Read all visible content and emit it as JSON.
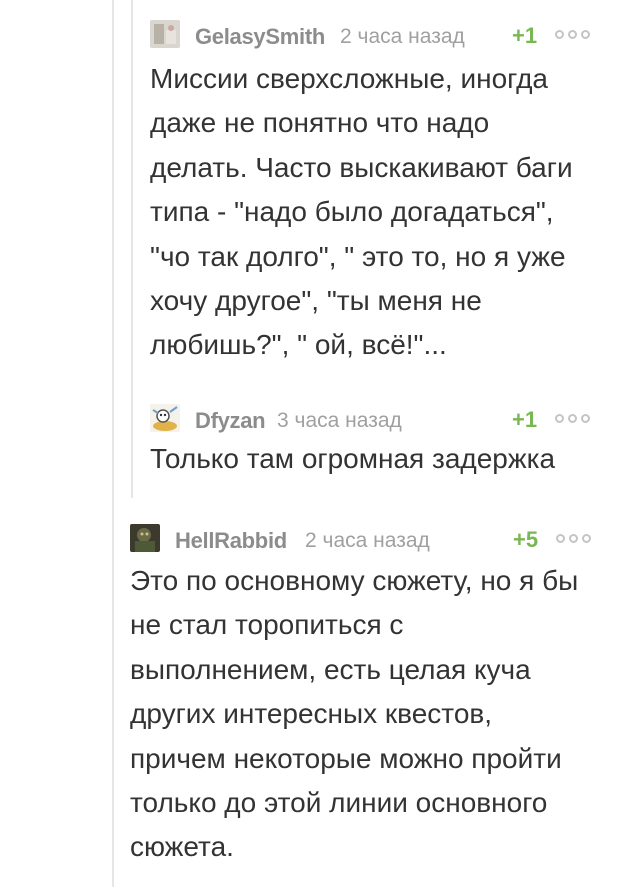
{
  "comments": [
    {
      "author": "GelasySmith",
      "time": "2 часа назад",
      "rating": "+1",
      "lines": [
        "Миссии сверхсложные, иногда",
        "даже не понятно что надо",
        "делать. Часто выскакивают баги",
        "типа - \"надо было догадаться\",",
        "\"чо так долго\", \" это то, но я уже",
        "хочу другое\", \"ты меня не",
        "любишь?\", \" ой, всё!\"..."
      ]
    },
    {
      "author": "Dfyzan",
      "time": "3 часа назад",
      "rating": "+1",
      "lines": [
        "Только там огромная задержка"
      ]
    },
    {
      "author": "HellRabbid",
      "time": "2 часа назад",
      "rating": "+5",
      "lines": [
        "Это по основному сюжету, но я бы",
        "не стал торопиться с",
        "выполнением, есть целая куча",
        "других интересных квестов,",
        "причем некоторые можно пройти",
        "только до этой линии основного",
        "сюжета."
      ]
    }
  ],
  "colors": {
    "author": "#8c8c8c",
    "time": "#a0a0a0",
    "rating_positive": "#79b753",
    "text": "#333333",
    "thread_line": "#e6e6e6",
    "more_dots": "#c4c4c4"
  },
  "icons": {
    "avatar_1": "user-avatar-icon",
    "avatar_2": "user-avatar-icon",
    "avatar_3": "user-avatar-icon",
    "more": "more-dots-icon"
  }
}
